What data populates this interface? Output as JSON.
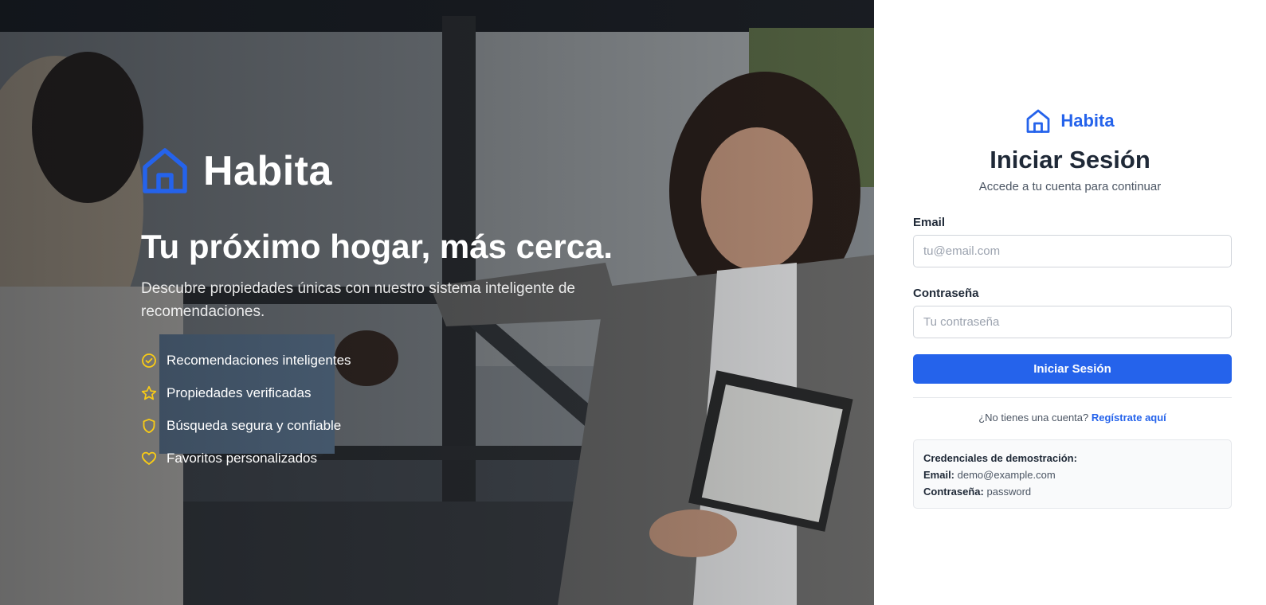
{
  "hero": {
    "brand_name": "Habita",
    "headline": "Tu próximo hogar, más cerca.",
    "subheadline": "Descubre propiedades únicas con nuestro sistema inteligente de recomendaciones.",
    "features": [
      {
        "icon": "check-circle-icon",
        "label": "Recomendaciones inteligentes"
      },
      {
        "icon": "star-icon",
        "label": "Propiedades verificadas"
      },
      {
        "icon": "shield-icon",
        "label": "Búsqueda segura y confiable"
      },
      {
        "icon": "heart-icon",
        "label": "Favoritos personalizados"
      }
    ],
    "feature_icon_color": "#facc15",
    "logo_color": "#2563eb"
  },
  "login": {
    "brand_name": "Habita",
    "title": "Iniciar Sesión",
    "subtitle": "Accede a tu cuenta para continuar",
    "email_label": "Email",
    "email_placeholder": "tu@email.com",
    "email_value": "",
    "password_label": "Contraseña",
    "password_placeholder": "Tu contraseña",
    "password_value": "",
    "submit_label": "Iniciar Sesión",
    "register_prompt": "¿No tienes una cuenta?",
    "register_link": "Regístrate aquí",
    "accent_color": "#2563eb"
  },
  "demo": {
    "heading": "Credenciales de demostración:",
    "email_label": "Email:",
    "email_value": "demo@example.com",
    "password_label": "Contraseña:",
    "password_value": "password"
  }
}
